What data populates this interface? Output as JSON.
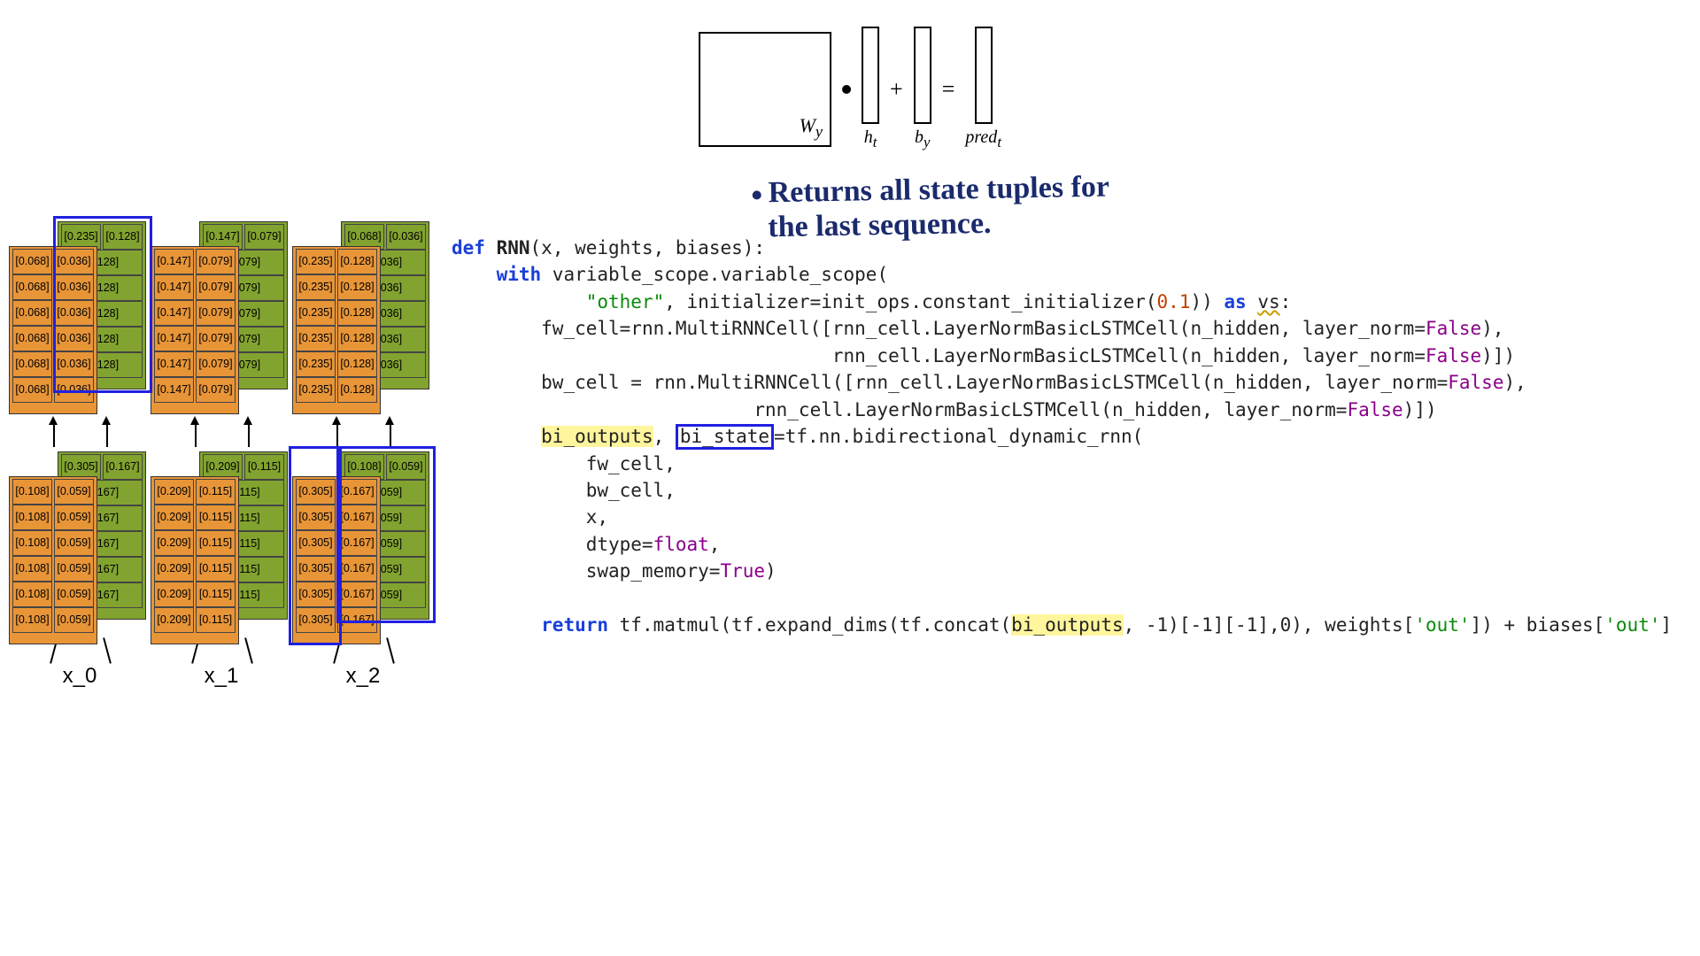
{
  "equation": {
    "Wy": "W",
    "Wy_sub": "y",
    "ht": "h",
    "ht_sub": "t",
    "by": "b",
    "by_sub": "y",
    "pred": "pred",
    "pred_sub": "t",
    "plus": "+",
    "eq": "="
  },
  "handwriting": {
    "line1": "Returns all state tuples for",
    "line2": "the  last sequence."
  },
  "lstm": {
    "timesteps": [
      "x_0",
      "x_1",
      "x_2"
    ],
    "top_layer": {
      "orange_pairs": [
        [
          "[0.068]",
          "[0.036]"
        ],
        [
          "[0.147]",
          "[0.079]"
        ],
        [
          "[0.235]",
          "[0.128]"
        ]
      ],
      "green_tops": [
        [
          "[0.235]",
          "[0.128]"
        ],
        [
          "[0.147]",
          "[0.079]"
        ],
        [
          "[0.068]",
          "[0.036]"
        ]
      ],
      "green_stack": [
        [
          "[0.128]",
          "[0.128]",
          "[0.128]",
          "[0.128]",
          "[0.128]"
        ],
        [
          "[0.079]",
          "[0.079]",
          "[0.079]",
          "[0.079]",
          "[0.079]"
        ],
        [
          "[0.036]",
          "[0.036]",
          "[0.036]",
          "[0.036]",
          "[0.036]"
        ]
      ]
    },
    "bottom_layer": {
      "orange_pairs": [
        [
          "[0.108]",
          "[0.059]"
        ],
        [
          "[0.209]",
          "[0.115]"
        ],
        [
          "[0.305]",
          "[0.167]"
        ]
      ],
      "green_tops": [
        [
          "[0.305]",
          "[0.167]"
        ],
        [
          "[0.209]",
          "[0.115]"
        ],
        [
          "[0.108]",
          "[0.059]"
        ]
      ],
      "green_stack": [
        [
          "[0.167]",
          "[0.167]",
          "[0.167]",
          "[0.167]",
          "[0.167]"
        ],
        [
          "[0.115]",
          "[0.115]",
          "[0.115]",
          "[0.115]",
          "[0.115]"
        ],
        [
          "[0.059]",
          "[0.059]",
          "[0.059]",
          "[0.059]",
          "[0.059]"
        ]
      ]
    }
  },
  "code": {
    "def": "def",
    "fnname": "RNN",
    "sig_rest": "(x, weights, biases):",
    "with": "with",
    "vscope": " variable_scope.variable_scope(",
    "str_other": "\"other\"",
    "init_rest": ", initializer=init_ops.constant_initializer(",
    "num_01": "0.1",
    "as": "as",
    "vs": "vs",
    "close_paren_colon": ":",
    "fw_assign": "fw_cell=rnn.MultiRNNCell([rnn_cell.LayerNormBasicLSTMCell(n_hidden, layer_norm=",
    "false": "False",
    "comma_close": "),",
    "fw_line2_pad": "                                  rnn_cell.LayerNormBasicLSTMCell(n_hidden, layer_norm=",
    "close_list": ")])",
    "bw_assign": "bw_cell = rnn.MultiRNNCell([rnn_cell.LayerNormBasicLSTMCell(n_hidden, layer_norm=",
    "bw_line2_pad": "                           rnn_cell.LayerNormBasicLSTMCell(n_hidden, layer_norm=",
    "bi_outputs": "bi_outputs",
    "comma": ", ",
    "bi_state": "bi_state",
    "bdrnn": "=tf.nn.bidirectional_dynamic_rnn(",
    "arg_fw": "fw_cell,",
    "arg_bw": "bw_cell,",
    "arg_x": "x,",
    "arg_dtype": "dtype=",
    "float": "float",
    "arg_swap": "swap_memory=",
    "true": "True",
    "close_call": ")",
    "return": "return",
    "ret_body1": " tf.matmul(tf.expand_dims(tf.concat(",
    "ret_bi": "bi_outputs",
    "ret_body2": ", -1)[-1][-1],0), weights[",
    "out1": "'out'",
    "ret_body3": "]) + biases[",
    "out2": "'out'",
    "ret_body4": "]"
  }
}
